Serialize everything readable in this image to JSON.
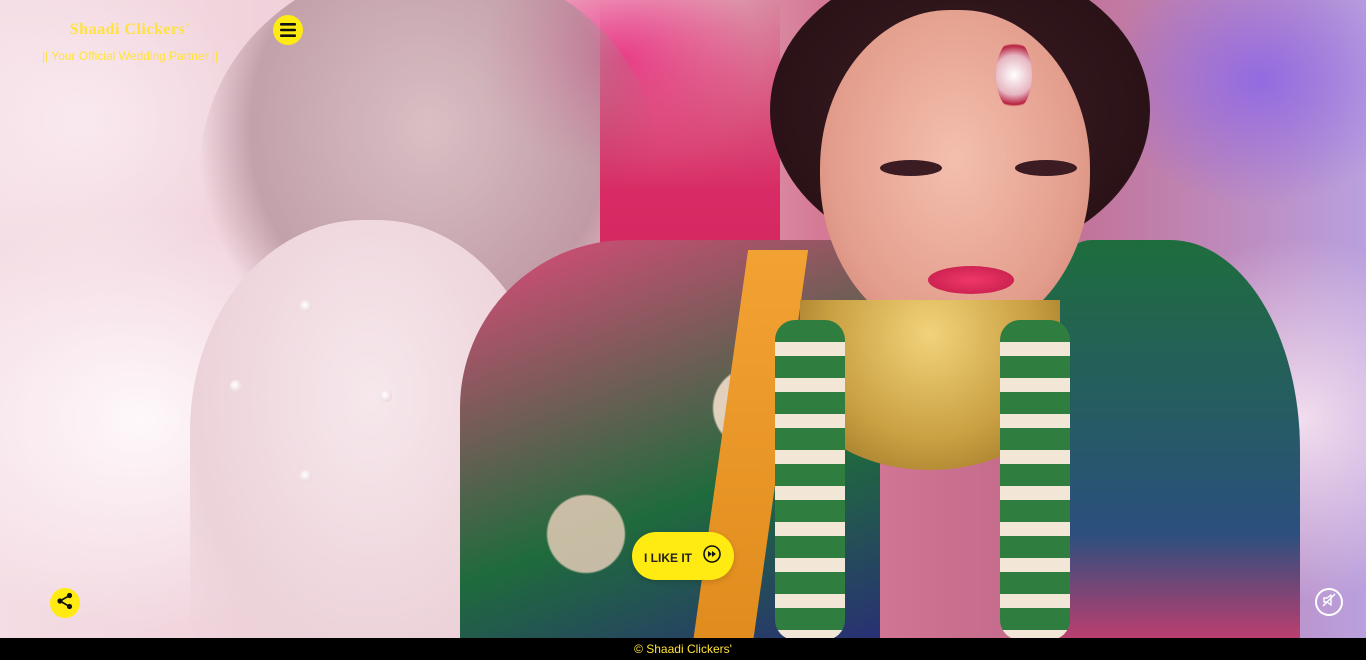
{
  "brand": {
    "title": "Shaadi Clickers'",
    "tagline": "|| Your Official Wedding Partner ||"
  },
  "actions": {
    "like_label": "I LIKE IT"
  },
  "footer": {
    "copyright": "© Shaadi Clickers'"
  },
  "icons": {
    "menu": "hamburger-menu-icon",
    "like": "fast-forward-circle-icon",
    "share": "share-icon",
    "mute": "mute-sound-icon"
  },
  "colors": {
    "accent": "#ffea12",
    "brand_text": "#ffe33c",
    "footer_bg": "#000000"
  },
  "hero": {
    "image": "bride-photo-background"
  }
}
